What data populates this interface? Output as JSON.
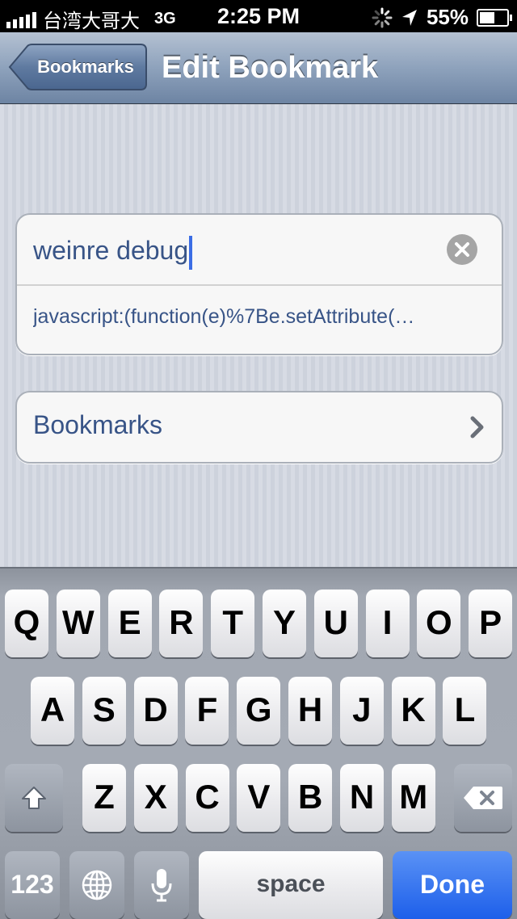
{
  "status_bar": {
    "carrier": "台湾大哥大",
    "network": "3G",
    "time": "2:25 PM",
    "battery": "55%",
    "battery_level": 0.55,
    "icons": [
      "signal-bars-icon",
      "activity-spinner-icon",
      "location-arrow-icon",
      "battery-icon"
    ]
  },
  "nav": {
    "back_label": "Bookmarks",
    "title": "Edit Bookmark"
  },
  "form": {
    "title_value": "weinre debug",
    "url_value": "javascript:(function(e)%7Be.setAttribute(…",
    "folder_label": "Bookmarks"
  },
  "keyboard": {
    "row1": [
      "Q",
      "W",
      "E",
      "R",
      "T",
      "Y",
      "U",
      "I",
      "O",
      "P"
    ],
    "row2": [
      "A",
      "S",
      "D",
      "F",
      "G",
      "H",
      "J",
      "K",
      "L"
    ],
    "row3": [
      "Z",
      "X",
      "C",
      "V",
      "B",
      "N",
      "M"
    ],
    "numbers_label": "123",
    "space_label": "space",
    "done_label": "Done"
  },
  "colors": {
    "link_text": "#385487",
    "done_key": "#1d5fea",
    "caret": "#3b6de5"
  }
}
